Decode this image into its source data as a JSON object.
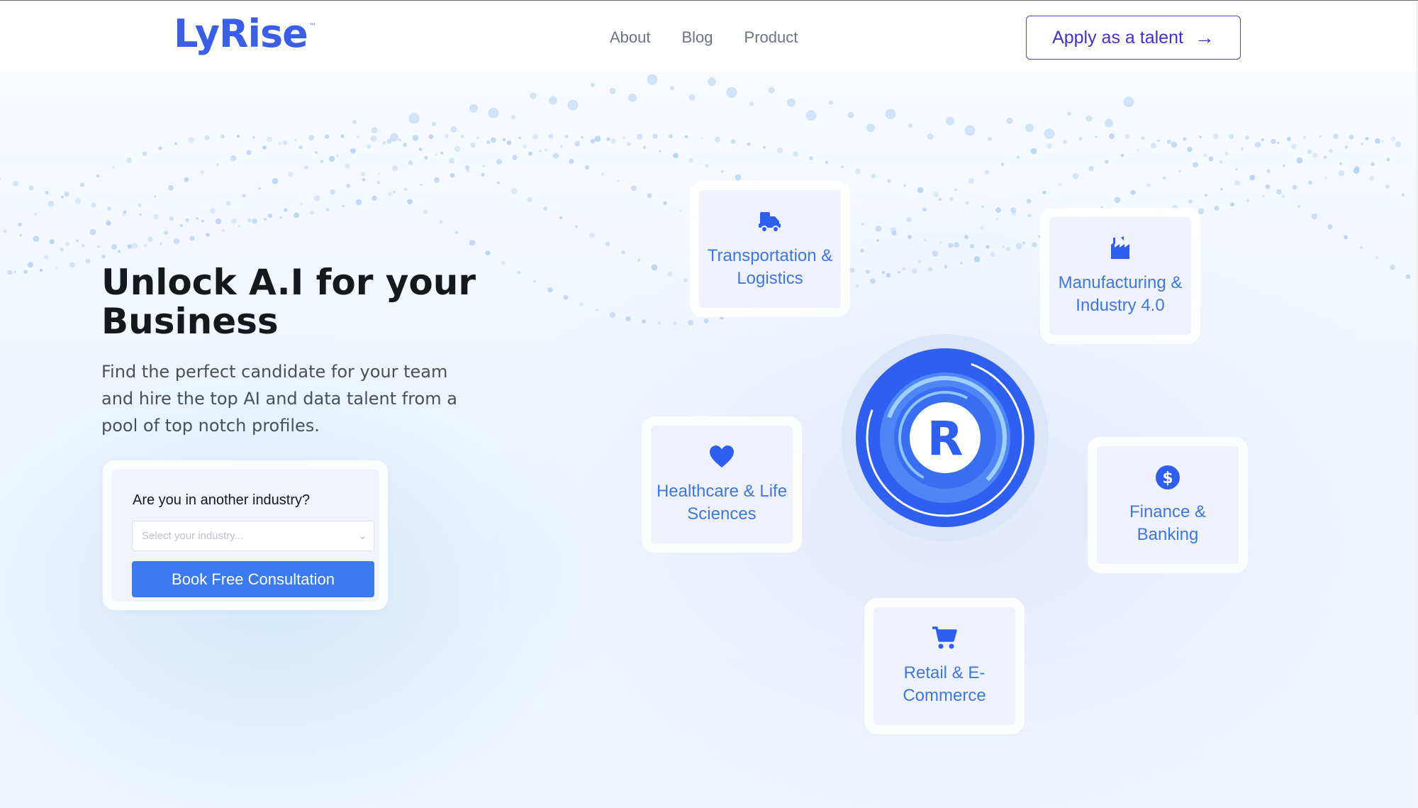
{
  "header": {
    "logo_text": "LyRise",
    "logo_tm": "™",
    "nav": [
      {
        "label": "About"
      },
      {
        "label": "Blog"
      },
      {
        "label": "Product"
      }
    ],
    "apply_label": "Apply as a talent",
    "apply_arrow": "→"
  },
  "hero": {
    "title": "Unlock A.I for your Business",
    "subtitle": "Find the perfect candidate for your team and hire the top AI and data talent from a pool of top notch profiles."
  },
  "form": {
    "question": "Are you in another industry?",
    "select_placeholder": "Select your industry...",
    "book_label": "Book Free Consultation"
  },
  "industries": [
    {
      "label": "Transportation & Logistics",
      "icon": "truck-icon"
    },
    {
      "label": "Manufacturing & Industry 4.0",
      "icon": "factory-icon"
    },
    {
      "label": "Healthcare & Life Sciences",
      "icon": "heart-icon"
    },
    {
      "label": "Finance & Banking",
      "icon": "dollar-icon"
    },
    {
      "label": "Retail & E-Commerce",
      "icon": "cart-icon"
    }
  ],
  "hub_letter": "R",
  "colors": {
    "brand": "#3b5ee8",
    "apply_border": "#5a3fd0",
    "button": "#3b7bf0",
    "industry_text": "#3e77e6",
    "hub_blue": "#2f5ff0"
  }
}
